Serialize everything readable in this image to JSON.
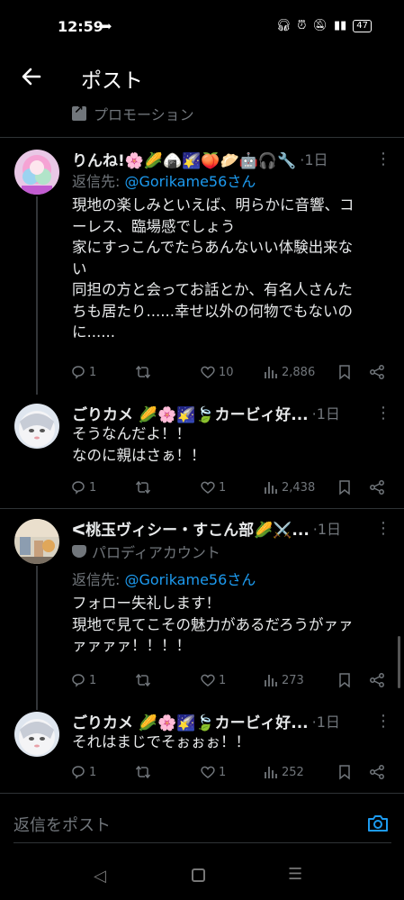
{
  "status_bar": {
    "time": "12:59",
    "battery": "47",
    "icons": [
      "headphones-icon",
      "alarm-icon",
      "mute-icon",
      "volte-icon",
      "signal-icon",
      "battery-icon"
    ]
  },
  "header": {
    "title": "ポスト",
    "back_icon": "back-arrow-icon"
  },
  "promo": {
    "label": "プロモーション"
  },
  "tweets": [
    {
      "name": "りんね!🌸🌽🍙🌠🍑🥟🤖🎧🔧",
      "time": "·1日",
      "reply_prefix": "返信先: ",
      "reply_to": "@Gorikame56さん",
      "body": [
        "現地の楽しみといえば、明らかに音響、コ",
        "ーレス、臨場感でしょう",
        "家にすっこんでたらあんないい体験出来な",
        "い",
        "同担の方と会ってお話とか、有名人さんた",
        "ちも居たり......幸せ以外の何物でもないの",
        "に......"
      ],
      "replies": "1",
      "retweets": "",
      "likes": "10",
      "views": "2,886"
    },
    {
      "name": "ごりカメ 🌽🌸🌠🍃カービィ好...",
      "time": "·1日",
      "body": [
        "そうなんだよ！！",
        "なのに親はさぁ！！"
      ],
      "replies": "1",
      "retweets": "",
      "likes": "1",
      "views": "2,438"
    },
    {
      "name": "ᐸ桃玉ヴィシー・すこん部🌽⚔️...",
      "time": "·1日",
      "sub_label": "パロディアカウント",
      "reply_prefix": "返信先: ",
      "reply_to": "@Gorikame56さん",
      "body": [
        "フォロー失礼します！",
        "現地で見てこその魅力があるだろうがァァ",
        "ァァァァ！！！！"
      ],
      "replies": "1",
      "retweets": "",
      "likes": "1",
      "views": "273"
    },
    {
      "name": "ごりカメ 🌽🌸🌠🍃カービィ好...",
      "time": "·1日",
      "body": [
        "それはまじでそぉぉぉ！！"
      ],
      "replies": "1",
      "retweets": "",
      "likes": "1",
      "views": "252"
    }
  ],
  "reply_bar": {
    "placeholder": "返信をポスト"
  },
  "colors": {
    "background": "#000000",
    "text": "#e7e9ea",
    "muted": "#71767b",
    "accent": "#1d9bf0"
  }
}
